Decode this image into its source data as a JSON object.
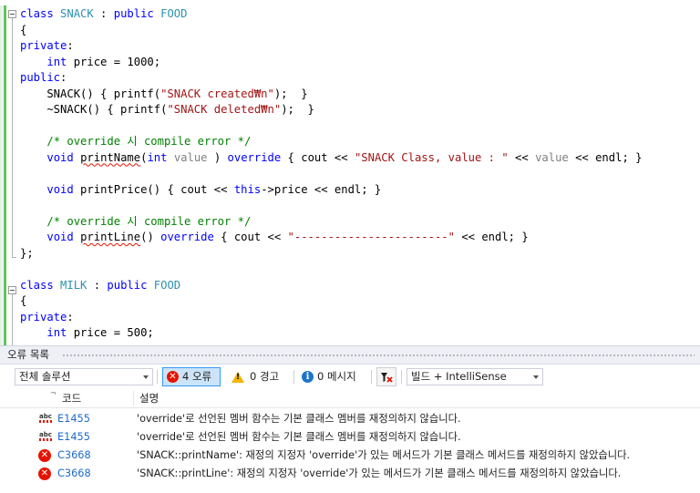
{
  "editor": {
    "lines": [
      {
        "t": [
          [
            "kw",
            "class "
          ],
          [
            "ty",
            "SNACK"
          ],
          [
            "",
            " : "
          ],
          [
            "kw",
            "public "
          ],
          [
            "ty",
            "FOOD"
          ]
        ]
      },
      {
        "t": [
          [
            "",
            "{"
          ]
        ]
      },
      {
        "t": [
          [
            "kw",
            "private"
          ],
          [
            "",
            ":"
          ]
        ]
      },
      {
        "t": [
          [
            "",
            "    "
          ],
          [
            "kw",
            "int"
          ],
          [
            "",
            " price = 1000;"
          ]
        ]
      },
      {
        "t": [
          [
            "kw",
            "public"
          ],
          [
            "",
            ":"
          ]
        ]
      },
      {
        "t": [
          [
            "",
            "    SNACK() { printf("
          ],
          [
            "st",
            "\"SNACK created₩n\""
          ],
          [
            "",
            ");  }"
          ]
        ]
      },
      {
        "t": [
          [
            "",
            "    ~SNACK() { printf("
          ],
          [
            "st",
            "\"SNACK deleted₩n\""
          ],
          [
            "",
            ");  }"
          ]
        ]
      },
      {
        "t": [
          [
            "",
            ""
          ]
        ]
      },
      {
        "t": [
          [
            "",
            "    "
          ],
          [
            "cm",
            "/* override 시 compile error */"
          ]
        ]
      },
      {
        "t": [
          [
            "",
            "    "
          ],
          [
            "kw",
            "void"
          ],
          [
            "",
            " "
          ],
          [
            "sq",
            "printName"
          ],
          [
            "",
            "("
          ],
          [
            "kw",
            "int"
          ],
          [
            "",
            " "
          ],
          [
            "pm",
            "value"
          ],
          [
            "",
            " ) "
          ],
          [
            "kw",
            "override"
          ],
          [
            "",
            " { cout << "
          ],
          [
            "st",
            "\"SNACK Class, value : \""
          ],
          [
            "",
            " << "
          ],
          [
            "pm",
            "value"
          ],
          [
            "",
            " << endl; }"
          ]
        ]
      },
      {
        "t": [
          [
            "",
            ""
          ]
        ]
      },
      {
        "t": [
          [
            "",
            "    "
          ],
          [
            "kw",
            "void"
          ],
          [
            "",
            " printPrice() { cout << "
          ],
          [
            "kw",
            "this"
          ],
          [
            "",
            "->price << endl; }"
          ]
        ]
      },
      {
        "t": [
          [
            "",
            ""
          ]
        ]
      },
      {
        "t": [
          [
            "",
            "    "
          ],
          [
            "cm",
            "/* override 시 compile error */"
          ]
        ]
      },
      {
        "t": [
          [
            "",
            "    "
          ],
          [
            "kw",
            "void"
          ],
          [
            "",
            " "
          ],
          [
            "sq",
            "printLine"
          ],
          [
            "",
            "() "
          ],
          [
            "kw",
            "override"
          ],
          [
            "",
            " { cout << "
          ],
          [
            "st",
            "\"-----------------------\""
          ],
          [
            "",
            " << endl; }"
          ]
        ]
      },
      {
        "t": [
          [
            "",
            "};"
          ]
        ]
      },
      {
        "t": [
          [
            "",
            ""
          ]
        ]
      },
      {
        "t": [
          [
            "kw",
            "class "
          ],
          [
            "ty",
            "MILK"
          ],
          [
            "",
            " : "
          ],
          [
            "kw",
            "public "
          ],
          [
            "ty",
            "FOOD"
          ]
        ]
      },
      {
        "t": [
          [
            "",
            "{"
          ]
        ]
      },
      {
        "t": [
          [
            "kw",
            "private"
          ],
          [
            "",
            ":"
          ]
        ]
      },
      {
        "t": [
          [
            "",
            "    "
          ],
          [
            "kw",
            "int"
          ],
          [
            "",
            " price = 500;"
          ]
        ]
      }
    ]
  },
  "error_list": {
    "title": "오류 목록",
    "scope_combo": "전체 솔루션",
    "errors_filter": "4 오류",
    "warnings_filter": "0 경고",
    "messages_filter": "0 메시지",
    "build_combo": "빌드 + IntelliSense",
    "col_code": "코드",
    "col_desc": "설명",
    "rows": [
      {
        "icon": "spell-error-icon",
        "code": "E1455",
        "desc": "'override'로 선언된 멤버 함수는 기본 클래스 멤버를 재정의하지 않습니다."
      },
      {
        "icon": "spell-error-icon",
        "code": "E1455",
        "desc": "'override'로 선언된 멤버 함수는 기본 클래스 멤버를 재정의하지 않습니다."
      },
      {
        "icon": "error-icon",
        "code": "C3668",
        "desc": "'SNACK::printName': 재정의 지정자 'override'가 있는 메서드가 기본 클래스 메서드를 재정의하지 않았습니다."
      },
      {
        "icon": "error-icon",
        "code": "C3668",
        "desc": "'SNACK::printLine': 재정의 지정자 'override'가 있는 메서드가 기본 클래스 메서드를 재정의하지 않았습니다."
      }
    ]
  },
  "colors": {
    "keyword": "#0000ff",
    "type": "#2b91af",
    "string": "#a31515",
    "comment": "#008000",
    "error": "#e51400"
  }
}
